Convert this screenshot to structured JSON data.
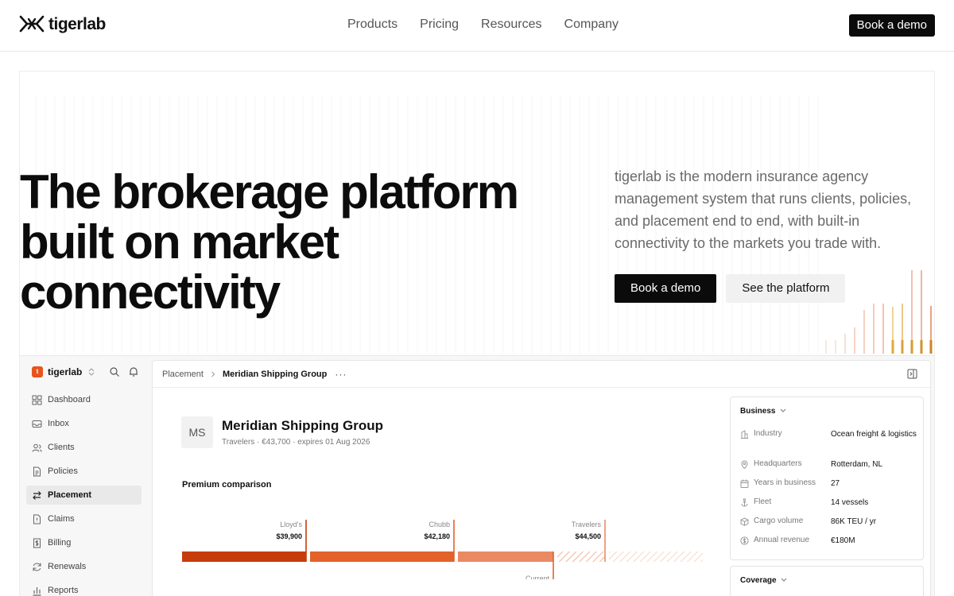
{
  "brand": {
    "name": "tigerlab",
    "accent": "#e8541d"
  },
  "nav": {
    "links": [
      "Products",
      "Pricing",
      "Resources",
      "Company"
    ],
    "cta": "Book a demo"
  },
  "hero": {
    "title_line1": "The brokerage platform",
    "title_line2": "built on market connectivity",
    "description": "tigerlab is the modern insurance agency management system that runs clients, policies, and placement end to end, with built-in connectivity to the markets you trade with.",
    "primary_cta": "Book a demo",
    "secondary_cta": "See the platform"
  },
  "app": {
    "workspace": "tigerlab",
    "workspace_badge": "t",
    "sidebar": [
      {
        "label": "Dashboard",
        "icon": "grid-icon",
        "active": false
      },
      {
        "label": "Inbox",
        "icon": "inbox-icon",
        "active": false
      },
      {
        "label": "Clients",
        "icon": "users-icon",
        "active": false
      },
      {
        "label": "Policies",
        "icon": "document-icon",
        "active": false
      },
      {
        "label": "Placement",
        "icon": "swap-icon",
        "active": true
      },
      {
        "label": "Claims",
        "icon": "alert-file-icon",
        "active": false
      },
      {
        "label": "Billing",
        "icon": "dollar-file-icon",
        "active": false
      },
      {
        "label": "Renewals",
        "icon": "refresh-icon",
        "active": false
      },
      {
        "label": "Reports",
        "icon": "bar-chart-icon",
        "active": false
      }
    ],
    "breadcrumb": {
      "parent": "Placement",
      "current": "Meridian Shipping Group",
      "more": "···"
    },
    "account": {
      "initials": "MS",
      "name": "Meridian Shipping Group",
      "subtitle": "Travelers · €43,700 · expires 01 Aug 2026"
    },
    "business_card": {
      "title": "Business",
      "facts": [
        {
          "label": "Industry",
          "value": "Ocean freight & logistics",
          "icon": "building-icon"
        },
        {
          "label": "Headquarters",
          "value": "Rotterdam, NL",
          "icon": "pin-icon"
        },
        {
          "label": "Years in business",
          "value": "27",
          "icon": "calendar-icon"
        },
        {
          "label": "Fleet",
          "value": "14 vessels",
          "icon": "anchor-icon"
        },
        {
          "label": "Cargo volume",
          "value": "86K TEU / yr",
          "icon": "box-icon"
        },
        {
          "label": "Annual revenue",
          "value": "€180M",
          "icon": "currency-icon"
        }
      ]
    },
    "coverage_card": {
      "title": "Coverage"
    }
  },
  "chart_data": {
    "type": "bar",
    "title": "Premium comparison",
    "markers": [
      {
        "name": "Lloyd's",
        "value": "$39,900"
      },
      {
        "name": "Chubb",
        "value": "$42,180"
      },
      {
        "name": "Travelers",
        "value": "$44,500"
      },
      {
        "name": "Current",
        "value": "€43,700"
      }
    ],
    "segment_colors": [
      "#c63d0c",
      "#e2622a",
      "#ea8a63",
      "#f4bfa5"
    ]
  }
}
